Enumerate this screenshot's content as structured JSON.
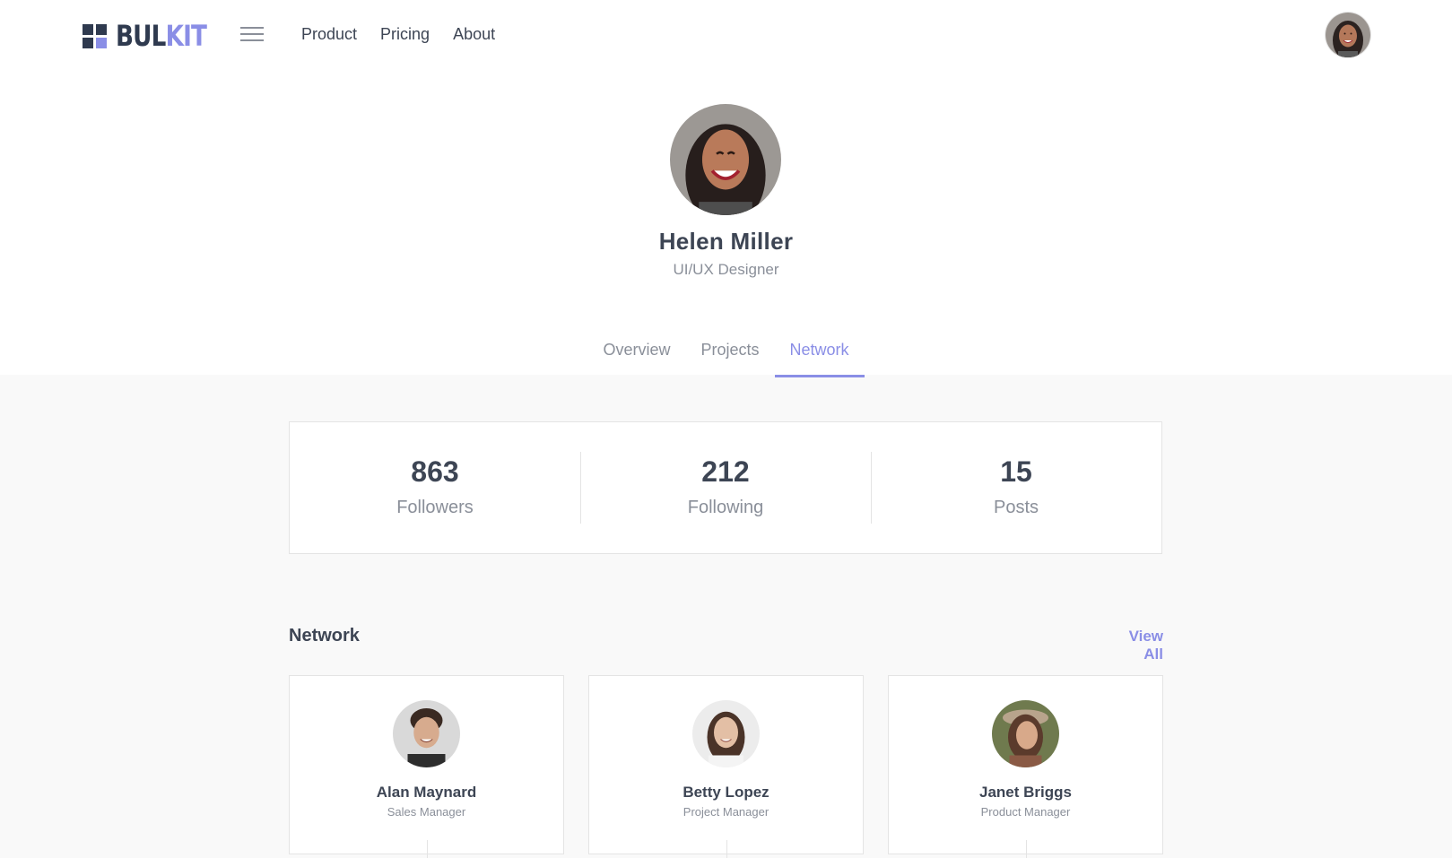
{
  "navbar": {
    "logo_text_dark": "BUL",
    "logo_text_accent": "KIT",
    "links": [
      "Product",
      "Pricing",
      "About"
    ]
  },
  "profile": {
    "name": "Helen Miller",
    "role": "UI/UX Designer"
  },
  "tabs": [
    {
      "label": "Overview",
      "active": false
    },
    {
      "label": "Projects",
      "active": false
    },
    {
      "label": "Network",
      "active": true
    }
  ],
  "stats": [
    {
      "value": "863",
      "label": "Followers"
    },
    {
      "value": "212",
      "label": "Following"
    },
    {
      "value": "15",
      "label": "Posts"
    }
  ],
  "network": {
    "title": "Network",
    "view_all": "View All",
    "people": [
      {
        "name": "Alan Maynard",
        "role": "Sales Manager"
      },
      {
        "name": "Betty Lopez",
        "role": "Project Manager"
      },
      {
        "name": "Janet Briggs",
        "role": "Product Manager"
      }
    ]
  },
  "colors": {
    "accent": "#8a8ee6",
    "text_dark": "#3d4554",
    "text_muted": "#8a8f99",
    "page_bg": "#f9f9f9"
  }
}
